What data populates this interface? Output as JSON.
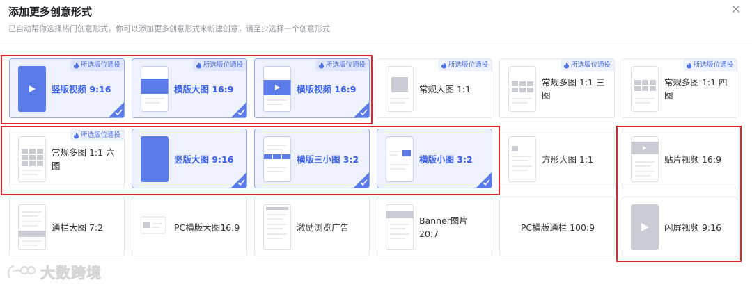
{
  "dialog": {
    "title": "添加更多创意形式",
    "subtitle": "已自动帮你选择热门创意形式，你可以添加更多创意形式来新建创意，请至少选择一个创意形式",
    "close_icon": "close-icon"
  },
  "badge_text": "所选版位通投",
  "colors": {
    "accent": "#3a5ee6",
    "highlight": "#e1252d",
    "selected_bg": "#eef2fd"
  },
  "cards": [
    {
      "label": "竖版视频 9:16",
      "selected": true,
      "badge": true,
      "thumb": "vertical-video"
    },
    {
      "label": "横版大图 16:9",
      "selected": true,
      "badge": true,
      "thumb": "horizontal-image"
    },
    {
      "label": "横版视频 16:9",
      "selected": true,
      "badge": true,
      "thumb": "horizontal-video"
    },
    {
      "label": "常规大图 1:1",
      "selected": false,
      "badge": true,
      "thumb": "square-image"
    },
    {
      "label": "常规多图 1:1 三图",
      "selected": false,
      "badge": true,
      "thumb": "grid-3"
    },
    {
      "label": "常规多图 1:1 四图",
      "selected": false,
      "badge": true,
      "thumb": "grid-4"
    },
    {
      "label": "常规多图 1:1 六图",
      "selected": false,
      "badge": true,
      "thumb": "grid-6"
    },
    {
      "label": "竖版大图 9:16",
      "selected": true,
      "badge": false,
      "thumb": "vertical-image"
    },
    {
      "label": "横版三小图 3:2",
      "selected": true,
      "badge": false,
      "thumb": "three-small"
    },
    {
      "label": "横版小图 3:2",
      "selected": true,
      "badge": false,
      "thumb": "small-image"
    },
    {
      "label": "方形大图 1:1",
      "selected": false,
      "badge": false,
      "thumb": "square-large"
    },
    {
      "label": "贴片视频 16:9",
      "selected": false,
      "badge": false,
      "thumb": "patch-video"
    },
    {
      "label": "通栏大图 7:2",
      "selected": false,
      "badge": false,
      "thumb": "banner-bar"
    },
    {
      "label": "PC横版大图16:9",
      "selected": false,
      "badge": false,
      "thumb": "pc-image"
    },
    {
      "label": "激励浏览广告",
      "selected": false,
      "badge": false,
      "thumb": "incentive"
    },
    {
      "label": "Banner图片 20:7",
      "selected": false,
      "badge": false,
      "thumb": "banner-image"
    },
    {
      "label": "PC横版通栏 100:9",
      "selected": false,
      "badge": false,
      "thumb": "none"
    },
    {
      "label": "闪屏视频 9:16",
      "selected": false,
      "badge": false,
      "thumb": "splash-video"
    }
  ],
  "watermark": {
    "text": "大数跨境"
  }
}
